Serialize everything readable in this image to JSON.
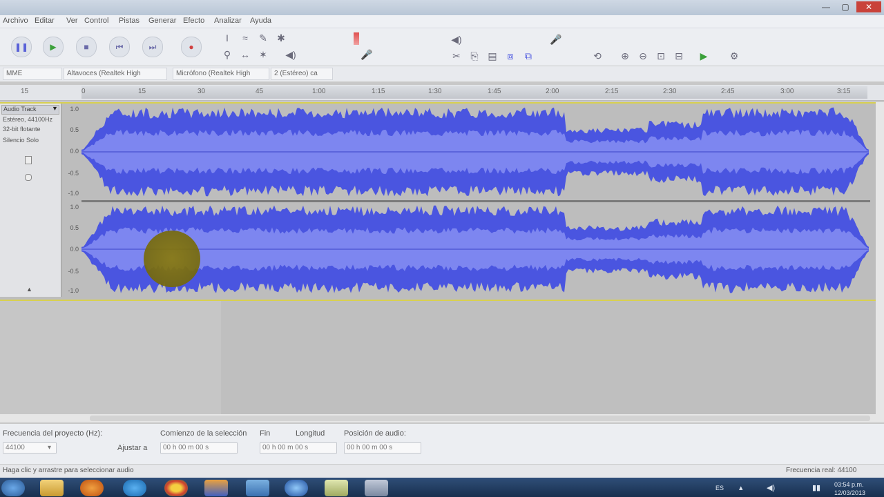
{
  "window": {
    "title": "",
    "controls": {
      "minimize": "—",
      "maximize": "▢",
      "close": "✕"
    }
  },
  "menu": {
    "items": [
      "Archivo",
      "Editar",
      "Ver",
      "Control",
      "Pistas",
      "Generar",
      "Efecto",
      "Analizar",
      "Ayuda"
    ]
  },
  "device_toolbar": {
    "host": "MME",
    "output_device": "Altavoces (Realtek High",
    "input_device": "Micrófono (Realtek High",
    "input_channels": "2 (Estéreo) ca"
  },
  "ruler": {
    "ticks": [
      "15",
      "0",
      "15",
      "30",
      "45",
      "1:00",
      "1:15",
      "1:30",
      "1:45",
      "2:00",
      "2:15",
      "2:30",
      "2:45",
      "3:00",
      "3:15"
    ]
  },
  "track": {
    "name": "Audio Track",
    "info_lines": [
      "Estéreo, 44100Hz",
      "32-bit flotante",
      "Silencio  Solo"
    ],
    "channel1_scale": [
      "1.0",
      "0.5",
      "0.0",
      "-0.5",
      "-1.0"
    ],
    "channel2_scale": [
      "1.0",
      "0.5",
      "0.0",
      "-0.5",
      "-1.0"
    ]
  },
  "selection_toolbar": {
    "rate_label": "Frecuencia del proyecto (Hz):",
    "rate_value": "44100",
    "snap_label": "Ajustar a",
    "start_label": "Comienzo de la selección",
    "end_label": "Fin",
    "length_label": "Longitud",
    "position_label": "Posición de audio:",
    "start_value": "00 h 00 m 00 s",
    "end_value": "00 h 00 m 00 s",
    "position_value": "00 h 00 m 00 s"
  },
  "status": {
    "left": "Haga clic y arrastre para seleccionar audio",
    "right": "Frecuencia real: 44100"
  },
  "taskbar": {
    "lang": "ES",
    "clock": "03:54 p.m.",
    "date": "12/03/2013"
  },
  "colors": {
    "waveform": "#4a55e0",
    "waveform_light": "#7d86f0",
    "selection_border": "#d8d050"
  }
}
